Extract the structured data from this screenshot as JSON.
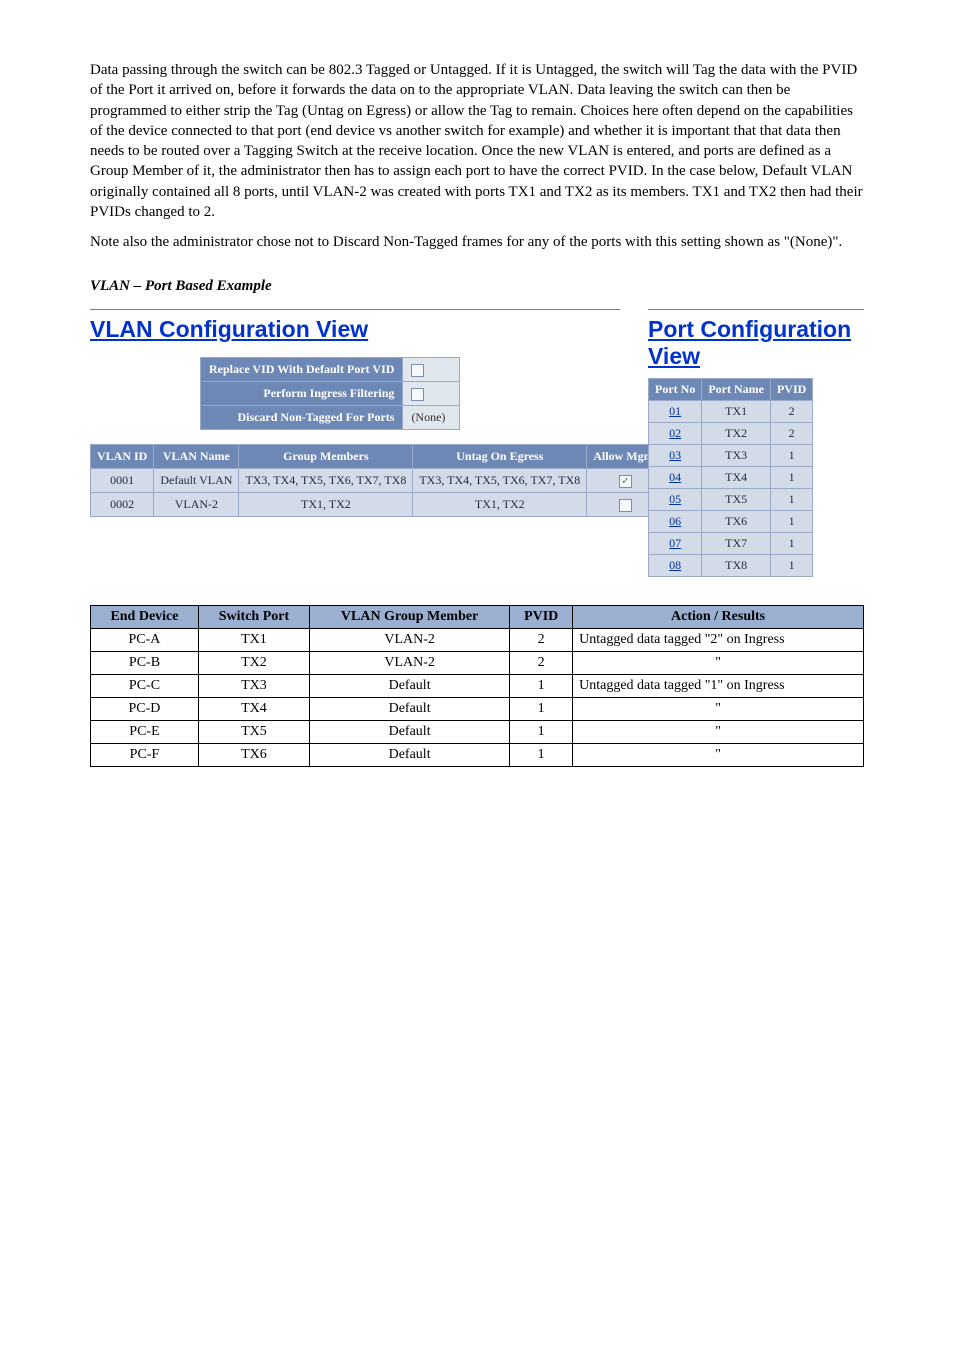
{
  "intro": {
    "p1": "Data passing through the switch can be 802.3 Tagged or Untagged. If it is Untagged, the switch will Tag the data with the PVID of the Port it arrived on, before it forwards the data on to the appropriate VLAN. Data leaving the switch can then be programmed to either strip the Tag (Untag on Egress) or allow the Tag to remain. Choices here often depend on the capabilities of the device connected to that port (end device vs another switch for example) and whether it is important that that data then needs to be routed over a Tagging Switch at the receive location. Once the new VLAN is entered, and ports are defined as a Group Member of it, the administrator then has to assign each port to have the correct PVID. In the case below, Default VLAN originally contained all 8 ports, until VLAN-2 was created with ports TX1 and TX2 as its members. TX1 and TX2 then had their PVIDs changed to 2.",
    "p2": "Note also the administrator chose not to Discard Non-Tagged frames for any of the ports with this setting shown as \"(None)\"."
  },
  "heading": "VLAN – Port Based Example",
  "img_left": {
    "title": "VLAN Configuration View",
    "opt1_label": "Replace VID With Default Port VID",
    "opt2_label": "Perform Ingress Filtering",
    "opt3_label": "Discard Non-Tagged For Ports",
    "opt3_value": "(None)",
    "headers": {
      "id": "VLAN ID",
      "name": "VLAN Name",
      "members": "Group Members",
      "untag": "Untag On Egress",
      "mgmt": "Allow Mgmt"
    },
    "rows": [
      {
        "id": "0001",
        "name": "Default VLAN",
        "members": "TX3, TX4, TX5, TX6, TX7, TX8",
        "untag": "TX3, TX4, TX5, TX6, TX7, TX8",
        "mgmt_check": "✓"
      },
      {
        "id": "0002",
        "name": "VLAN-2",
        "members": "TX1, TX2",
        "untag": "TX1, TX2",
        "mgmt_check": ""
      }
    ]
  },
  "img_right": {
    "title": "Port Configuration View",
    "headers": {
      "no": "Port No",
      "name": "Port Name",
      "pvid": "PVID"
    },
    "rows": [
      {
        "no": "01",
        "name": "TX1",
        "pvid": "2"
      },
      {
        "no": "02",
        "name": "TX2",
        "pvid": "2"
      },
      {
        "no": "03",
        "name": "TX3",
        "pvid": "1"
      },
      {
        "no": "04",
        "name": "TX4",
        "pvid": "1"
      },
      {
        "no": "05",
        "name": "TX5",
        "pvid": "1"
      },
      {
        "no": "06",
        "name": "TX6",
        "pvid": "1"
      },
      {
        "no": "07",
        "name": "TX7",
        "pvid": "1"
      },
      {
        "no": "08",
        "name": "TX8",
        "pvid": "1"
      }
    ]
  },
  "doc_table": {
    "headers": {
      "device": "End Device",
      "port": "Switch Port",
      "member": "VLAN Group Member",
      "pvid": "PVID",
      "action": "Action / Results"
    },
    "rows": [
      {
        "device": "PC-A",
        "port": "TX1",
        "member": "VLAN-2",
        "pvid": "2",
        "action": "Untagged data tagged \"2\" on Ingress"
      },
      {
        "device": "PC-B",
        "port": "TX2",
        "member": "VLAN-2",
        "pvid": "2",
        "action": "\""
      },
      {
        "device": "PC-C",
        "port": "TX3",
        "member": "Default",
        "pvid": "1",
        "action": "Untagged data tagged \"1\" on Ingress"
      },
      {
        "device": "PC-D",
        "port": "TX4",
        "member": "Default",
        "pvid": "1",
        "action": "\""
      },
      {
        "device": "PC-E",
        "port": "TX5",
        "member": "Default",
        "pvid": "1",
        "action": "\""
      },
      {
        "device": "PC-F",
        "port": "TX6",
        "member": "Default",
        "pvid": "1",
        "action": "\""
      }
    ]
  }
}
